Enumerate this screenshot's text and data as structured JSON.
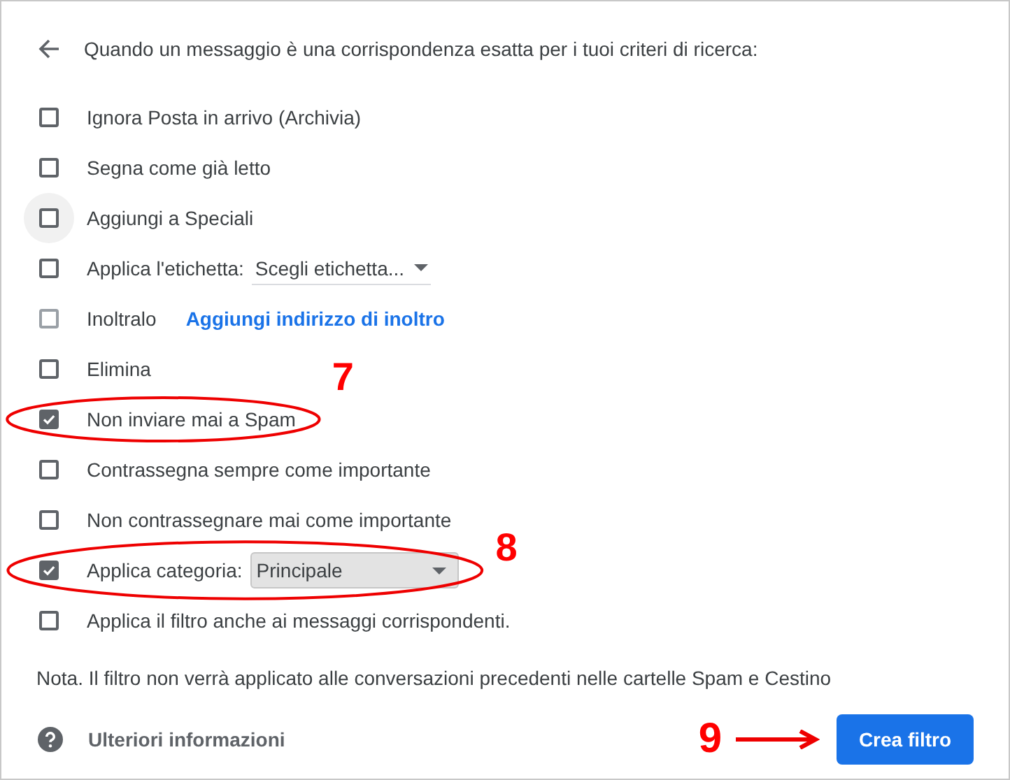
{
  "header": {
    "text": "Quando un messaggio è una corrispondenza esatta per i tuoi criteri di ricerca:"
  },
  "options": [
    {
      "kind": "plain",
      "label": "Ignora Posta in arrivo (Archivia)",
      "checked": false,
      "disabled": false,
      "hovered": false
    },
    {
      "kind": "plain",
      "label": "Segna come già letto",
      "checked": false,
      "disabled": false,
      "hovered": false
    },
    {
      "kind": "plain",
      "label": "Aggiungi a Speciali",
      "checked": false,
      "disabled": false,
      "hovered": true
    },
    {
      "kind": "select",
      "label": "Applica l'etichetta:",
      "value": "Scegli etichetta...",
      "boxed": false,
      "checked": false,
      "disabled": false,
      "hovered": false
    },
    {
      "kind": "link",
      "label": "Inoltralo",
      "link": "Aggiungi indirizzo di inoltro",
      "checked": false,
      "disabled": true,
      "hovered": false
    },
    {
      "kind": "plain",
      "label": "Elimina",
      "checked": false,
      "disabled": false,
      "hovered": false
    },
    {
      "kind": "plain",
      "label": "Non inviare mai a Spam",
      "checked": true,
      "disabled": false,
      "hovered": false,
      "marker": "7"
    },
    {
      "kind": "plain",
      "label": "Contrassegna sempre come importante",
      "checked": false,
      "disabled": false,
      "hovered": false
    },
    {
      "kind": "plain",
      "label": "Non contrassegnare mai come importante",
      "checked": false,
      "disabled": false,
      "hovered": false
    },
    {
      "kind": "select",
      "label": "Applica categoria:",
      "value": "Principale",
      "boxed": true,
      "checked": true,
      "disabled": false,
      "hovered": false,
      "marker": "8"
    },
    {
      "kind": "plain",
      "label": "Applica il filtro anche ai messaggi corrispondenti.",
      "checked": false,
      "disabled": false,
      "hovered": false
    }
  ],
  "note": "Nota. Il filtro non verrà applicato alle conversazioni precedenti nelle cartelle Spam e Cestino",
  "footer": {
    "help_link": "Ulteriori informazioni",
    "button": "Crea filtro",
    "button_marker": "9"
  }
}
